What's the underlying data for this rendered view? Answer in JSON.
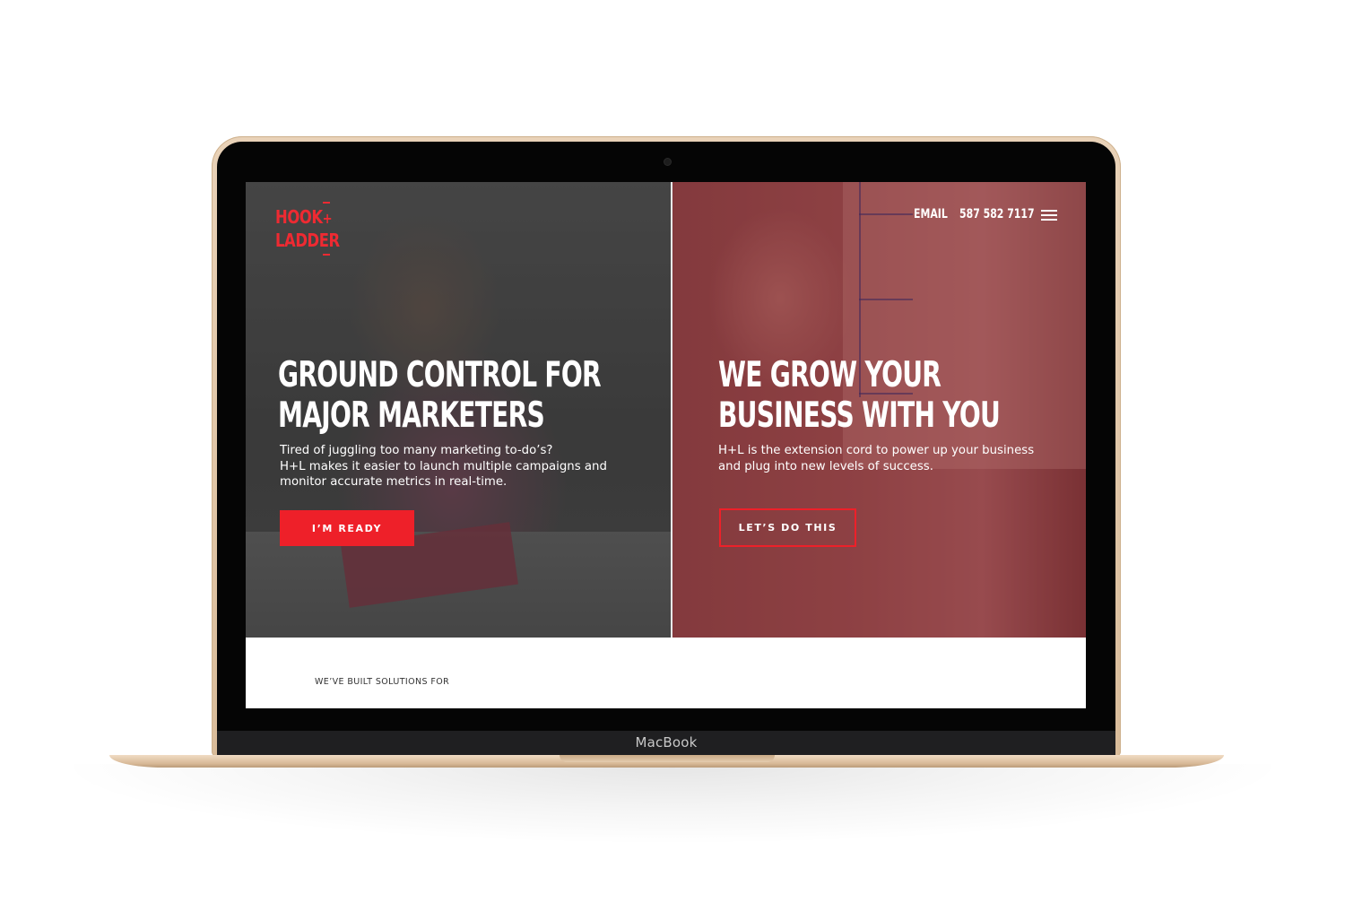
{
  "device": {
    "brand_label": "MacBook"
  },
  "site": {
    "logo": {
      "line1": "HOOK",
      "plus": "+",
      "line2": "LADDER"
    },
    "nav": {
      "email_label": "EMAIL",
      "phone_label": "587 582 7117",
      "menu_icon": "hamburger-icon"
    },
    "hero_left": {
      "title_line1": "GROUND CONTROL FOR",
      "title_line2": "MAJOR MARKETERS",
      "text_line1": "Tired of juggling too many marketing to-do’s?",
      "text_line2": "H+L makes it easier to launch multiple campaigns and",
      "text_line3": "monitor accurate metrics in real-time.",
      "button_label": "I’M READY"
    },
    "hero_right": {
      "title_line1": "WE GROW YOUR",
      "title_line2": "BUSINESS WITH YOU",
      "text_line1": "H+L is the extension cord to power up your business",
      "text_line2": "and plug into new levels of success.",
      "button_label": "LET’S DO THIS"
    },
    "solutions_heading": "WE’VE BUILT SOLUTIONS FOR"
  },
  "colors": {
    "brand_red": "#ee2029",
    "right_panel_tint": "#6a3134",
    "left_panel_tint": "#3e3e3e",
    "laptop_gold": "#e2c7a8"
  }
}
